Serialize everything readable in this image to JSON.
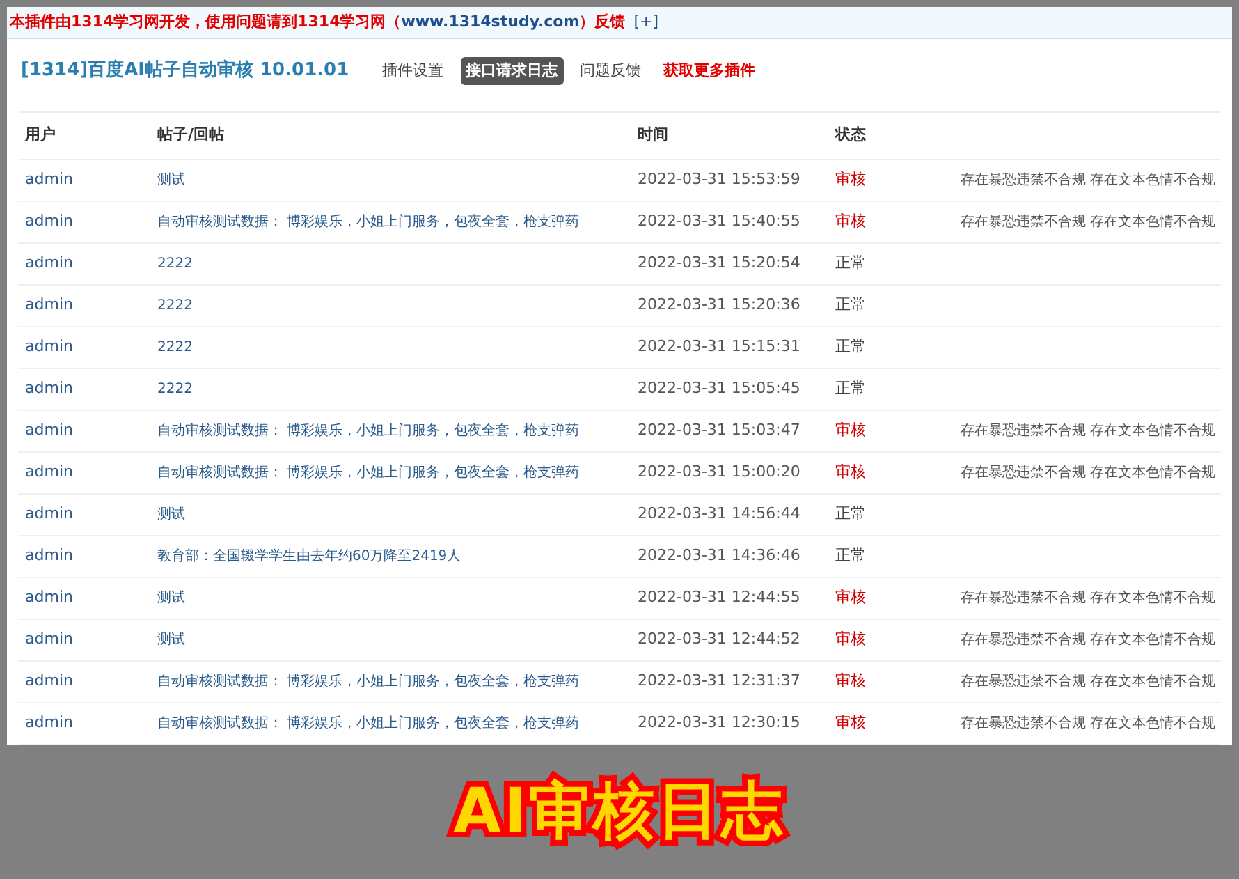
{
  "notice": {
    "text": "本插件由1314学习网开发，使用问题请到1314学习网（",
    "link": "www.1314study.com",
    "suffix": "）反馈",
    "expand": "[+]"
  },
  "header": {
    "title": "[1314]百度AI帖子自动审核 10.01.01",
    "tabs": [
      {
        "label": "插件设置",
        "selected": false,
        "kind": "tab"
      },
      {
        "label": "接口请求日志",
        "selected": true,
        "kind": "tab"
      },
      {
        "label": "问题反馈",
        "selected": false,
        "kind": "tab"
      },
      {
        "label": "获取更多插件",
        "selected": false,
        "kind": "promo"
      }
    ]
  },
  "table": {
    "columns": [
      "用户",
      "帖子/回帖",
      "时间",
      "状态"
    ],
    "rows": [
      {
        "user": "admin",
        "post": "测试",
        "time": "2022-03-31 15:53:59",
        "status": "审核",
        "flagged": true,
        "reason": "存在暴恐违禁不合规 存在文本色情不合规"
      },
      {
        "user": "admin",
        "post": "自动审核测试数据： 博彩娱乐，小姐上门服务，包夜全套，枪支弹药",
        "time": "2022-03-31 15:40:55",
        "status": "审核",
        "flagged": true,
        "reason": "存在暴恐违禁不合规 存在文本色情不合规"
      },
      {
        "user": "admin",
        "post": "2222",
        "time": "2022-03-31 15:20:54",
        "status": "正常",
        "flagged": false
      },
      {
        "user": "admin",
        "post": "2222",
        "time": "2022-03-31 15:20:36",
        "status": "正常",
        "flagged": false
      },
      {
        "user": "admin",
        "post": "2222",
        "time": "2022-03-31 15:15:31",
        "status": "正常",
        "flagged": false
      },
      {
        "user": "admin",
        "post": "2222",
        "time": "2022-03-31 15:05:45",
        "status": "正常",
        "flagged": false
      },
      {
        "user": "admin",
        "post": "自动审核测试数据： 博彩娱乐，小姐上门服务，包夜全套，枪支弹药",
        "time": "2022-03-31 15:03:47",
        "status": "审核",
        "flagged": true,
        "reason": "存在暴恐违禁不合规 存在文本色情不合规"
      },
      {
        "user": "admin",
        "post": "自动审核测试数据： 博彩娱乐，小姐上门服务，包夜全套，枪支弹药",
        "time": "2022-03-31 15:00:20",
        "status": "审核",
        "flagged": true,
        "reason": "存在暴恐违禁不合规 存在文本色情不合规"
      },
      {
        "user": "admin",
        "post": "测试",
        "time": "2022-03-31 14:56:44",
        "status": "正常",
        "flagged": false
      },
      {
        "user": "admin",
        "post": "教育部：全国辍学学生由去年约60万降至2419人",
        "time": "2022-03-31 14:36:46",
        "status": "正常",
        "flagged": false
      },
      {
        "user": "admin",
        "post": "测试",
        "time": "2022-03-31 12:44:55",
        "status": "审核",
        "flagged": true,
        "reason": "存在暴恐违禁不合规 存在文本色情不合规"
      },
      {
        "user": "admin",
        "post": "测试",
        "time": "2022-03-31 12:44:52",
        "status": "审核",
        "flagged": true,
        "reason": "存在暴恐违禁不合规 存在文本色情不合规"
      },
      {
        "user": "admin",
        "post": "自动审核测试数据： 博彩娱乐，小姐上门服务，包夜全套，枪支弹药",
        "time": "2022-03-31 12:31:37",
        "status": "审核",
        "flagged": true,
        "reason": "存在暴恐违禁不合规 存在文本色情不合规"
      },
      {
        "user": "admin",
        "post": "自动审核测试数据： 博彩娱乐，小姐上门服务，包夜全套，枪支弹药",
        "time": "2022-03-31 12:30:15",
        "status": "审核",
        "flagged": true,
        "reason": "存在暴恐违禁不合规 存在文本色情不合规"
      }
    ]
  },
  "banner": {
    "title": "AI审核日志"
  }
}
